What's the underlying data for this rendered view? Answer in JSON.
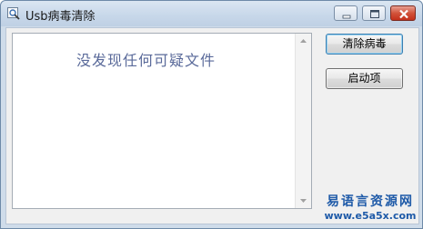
{
  "window": {
    "title": "Usb病毒清除",
    "icon": "magnifier-icon"
  },
  "list": {
    "message": "没发现任何可疑文件"
  },
  "buttons": {
    "clear_label": "清除病毒",
    "startup_label": "启动项"
  },
  "watermark": {
    "line1": "易语言资源网",
    "line2": "www.e5a5x.com"
  },
  "colors": {
    "title_bar": "#c8d8ea",
    "close_button": "#c4301b",
    "message_text": "#5a6a9a",
    "watermark": "#1e5aa8"
  }
}
